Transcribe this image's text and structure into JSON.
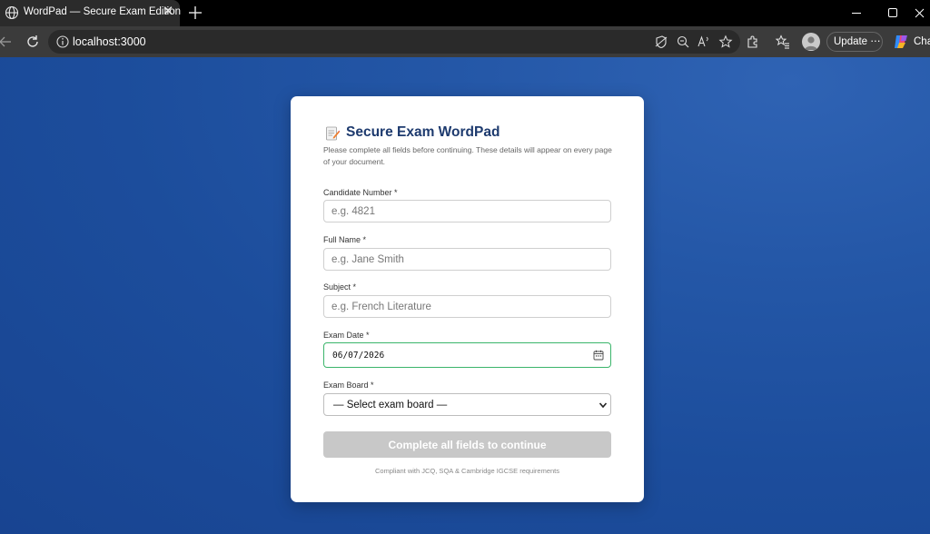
{
  "browser": {
    "tab_title": "WordPad — Secure Exam Edition",
    "tab_close_glyph": "✕",
    "url": "localhost:3000",
    "update_label": "Update",
    "update_more": "⋯",
    "chat_label": "Cha",
    "icons": [
      "globe-icon",
      "close-icon",
      "plus-icon",
      "minimize-icon",
      "maximize-icon",
      "window-close-icon",
      "back-icon",
      "refresh-icon",
      "info-icon",
      "tracking-icon",
      "zoom-out-icon",
      "read-aloud-icon",
      "star-icon",
      "extensions-icon",
      "favorites-icon",
      "profile-avatar",
      "copilot-icon"
    ]
  },
  "form": {
    "title_icon": "memo-icon",
    "title": "Secure Exam WordPad",
    "description": "Please complete all fields before continuing. These details will appear on every page of your document.",
    "fields": {
      "candidate_number": {
        "label": "Candidate Number *",
        "placeholder": "e.g. 4821",
        "value": ""
      },
      "full_name": {
        "label": "Full Name *",
        "placeholder": "e.g. Jane Smith",
        "value": ""
      },
      "subject": {
        "label": "Subject *",
        "placeholder": "e.g. French Literature",
        "value": ""
      },
      "exam_date": {
        "label": "Exam Date *",
        "value": "06/07/2026"
      },
      "exam_board": {
        "label": "Exam Board *",
        "selected": "— Select exam board —"
      }
    },
    "submit_label": "Complete all fields to continue",
    "submit_disabled": true,
    "compliance_note": "Compliant with JCQ, SQA & Cambridge IGCSE requirements"
  },
  "colors": {
    "title": "#1d3a6e",
    "background_blue": "#1c4d9c",
    "date_focus_border": "#3bb56b",
    "disabled_button": "#c8c8c8"
  }
}
